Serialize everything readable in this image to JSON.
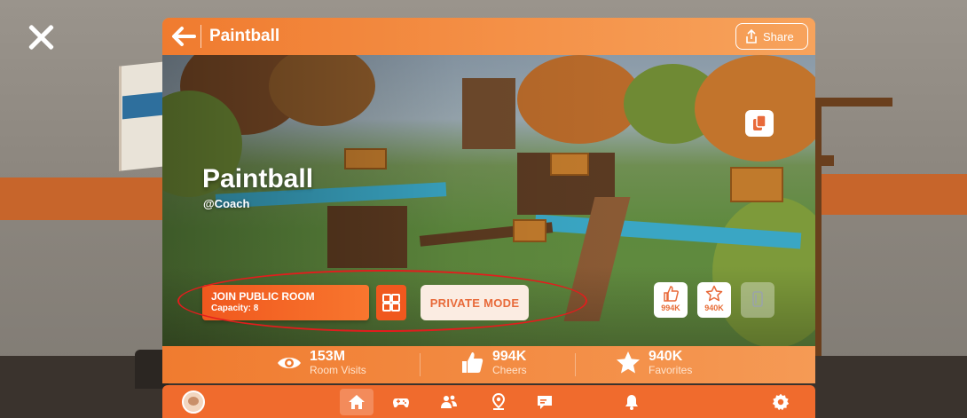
{
  "header": {
    "title": "Paintball",
    "share_label": "Share"
  },
  "room": {
    "title": "Paintball",
    "creator": "@Coach"
  },
  "actions": {
    "join_label": "JOIN PUBLIC ROOM",
    "capacity_label": "Capacity: 8",
    "private_label": "PRIVATE MODE"
  },
  "room_buttons": {
    "cheer_count": "994K",
    "favorite_count": "940K"
  },
  "stats": [
    {
      "value": "153M",
      "label": "Room Visits",
      "icon": "eye-icon"
    },
    {
      "value": "994K",
      "label": "Cheers",
      "icon": "thumbs-up-icon"
    },
    {
      "value": "940K",
      "label": "Favorites",
      "icon": "star-icon"
    }
  ],
  "nav": [
    "home-icon",
    "gamepad-icon",
    "people-icon",
    "location-icon",
    "chat-icon",
    "bell-icon",
    "gear-icon"
  ],
  "colors": {
    "accent": "#f07b2f",
    "join": "#f0581e",
    "highlight": "#e21d1d"
  }
}
